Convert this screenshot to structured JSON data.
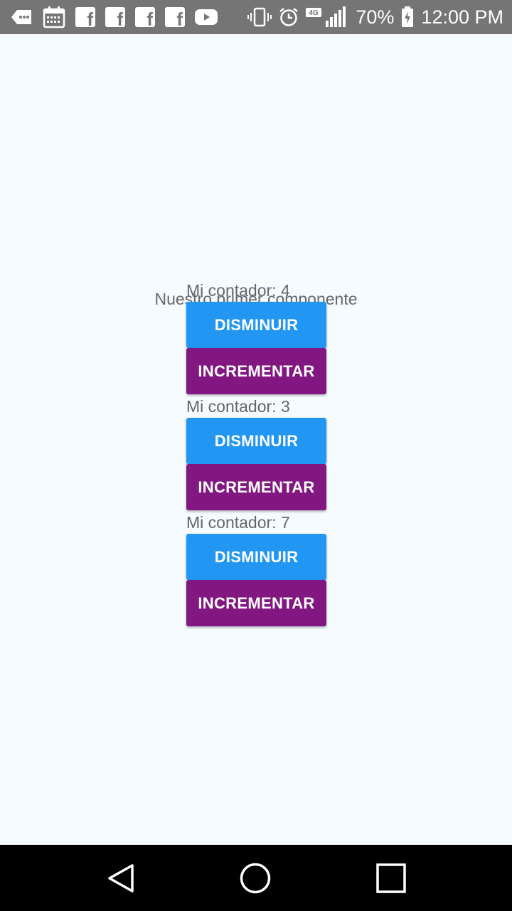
{
  "status_bar": {
    "battery_percent": "70%",
    "network": "4G",
    "time": "12:00 PM",
    "icons_left": [
      "messages-icon",
      "calendar-icon",
      "facebook-icon",
      "facebook-icon",
      "facebook-icon",
      "facebook-icon",
      "youtube-icon"
    ],
    "icons_right": [
      "vibrate-icon",
      "alarm-icon",
      "signal-icon",
      "battery-charging-icon"
    ]
  },
  "main": {
    "title": "Nuestro primer componente",
    "counters": [
      {
        "label": "Mi contador: 4",
        "decrement_label": "DISMINUIR",
        "increment_label": "INCREMENTAR"
      },
      {
        "label": "Mi contador: 3",
        "decrement_label": "DISMINUIR",
        "increment_label": "INCREMENTAR"
      },
      {
        "label": "Mi contador: 7",
        "decrement_label": "DISMINUIR",
        "increment_label": "INCREMENTAR"
      }
    ]
  },
  "colors": {
    "decrement_button": "#2196f3",
    "increment_button": "#831782",
    "background": "#f5fbff",
    "status_bar": "#757575"
  },
  "nav_bar": {
    "icons": [
      "back-icon",
      "home-icon",
      "recents-icon"
    ]
  }
}
